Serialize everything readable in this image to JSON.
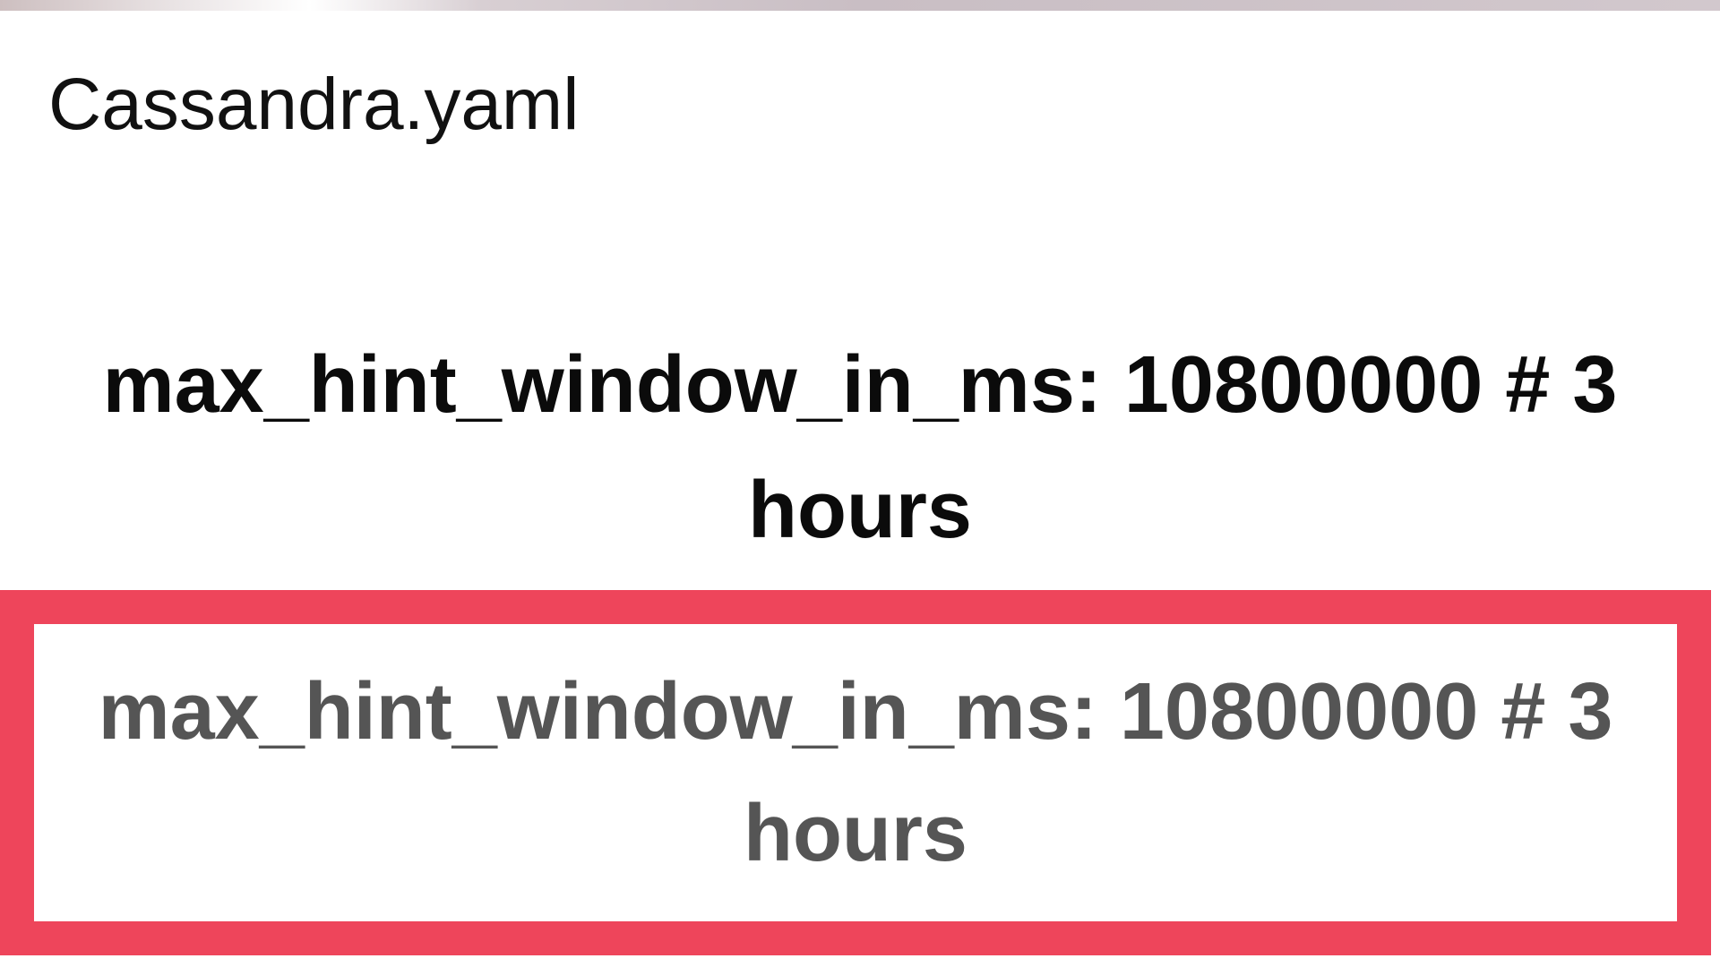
{
  "header": {
    "file_name": "Cassandra.yaml"
  },
  "main": {
    "config_line": "max_hint_window_in_ms: 10800000 # 3 hours"
  },
  "highlight": {
    "config_line": "max_hint_window_in_ms: 10800000 # 3 hours",
    "border_color": "#ee455b",
    "text_color": "#555555"
  }
}
